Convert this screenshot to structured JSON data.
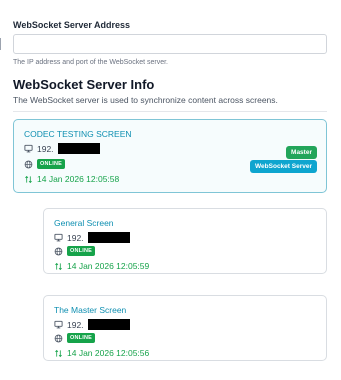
{
  "address_field": {
    "label": "WebSocket Server Address",
    "value": "",
    "help": "The IP address and port of the WebSocket server."
  },
  "info": {
    "title": "WebSocket Server Info",
    "description": "The WebSocket server is used to synchronize content across screens."
  },
  "screens": [
    {
      "name": "CODEC TESTING SCREEN",
      "ip_prefix": "192.",
      "status": "ONLINE",
      "timestamp": "14 Jan 2026 12:05:58",
      "badges": [
        "Master",
        "WebSocket Server"
      ]
    },
    {
      "name": "General Screen",
      "ip_prefix": "192.",
      "status": "ONLINE",
      "timestamp": "14 Jan 2026 12:05:59"
    },
    {
      "name": "The Master Screen",
      "ip_prefix": "192.",
      "status": "ONLINE",
      "timestamp": "14 Jan 2026 12:05:56"
    }
  ],
  "colors": {
    "accent": "#0e8fb1",
    "online": "#16a34a",
    "master_badge": "#22a55a",
    "ws_badge": "#0ea5cf"
  },
  "icons": {
    "ip": "monitor-icon",
    "status": "globe-icon",
    "time": "sync-arrows-icon"
  }
}
